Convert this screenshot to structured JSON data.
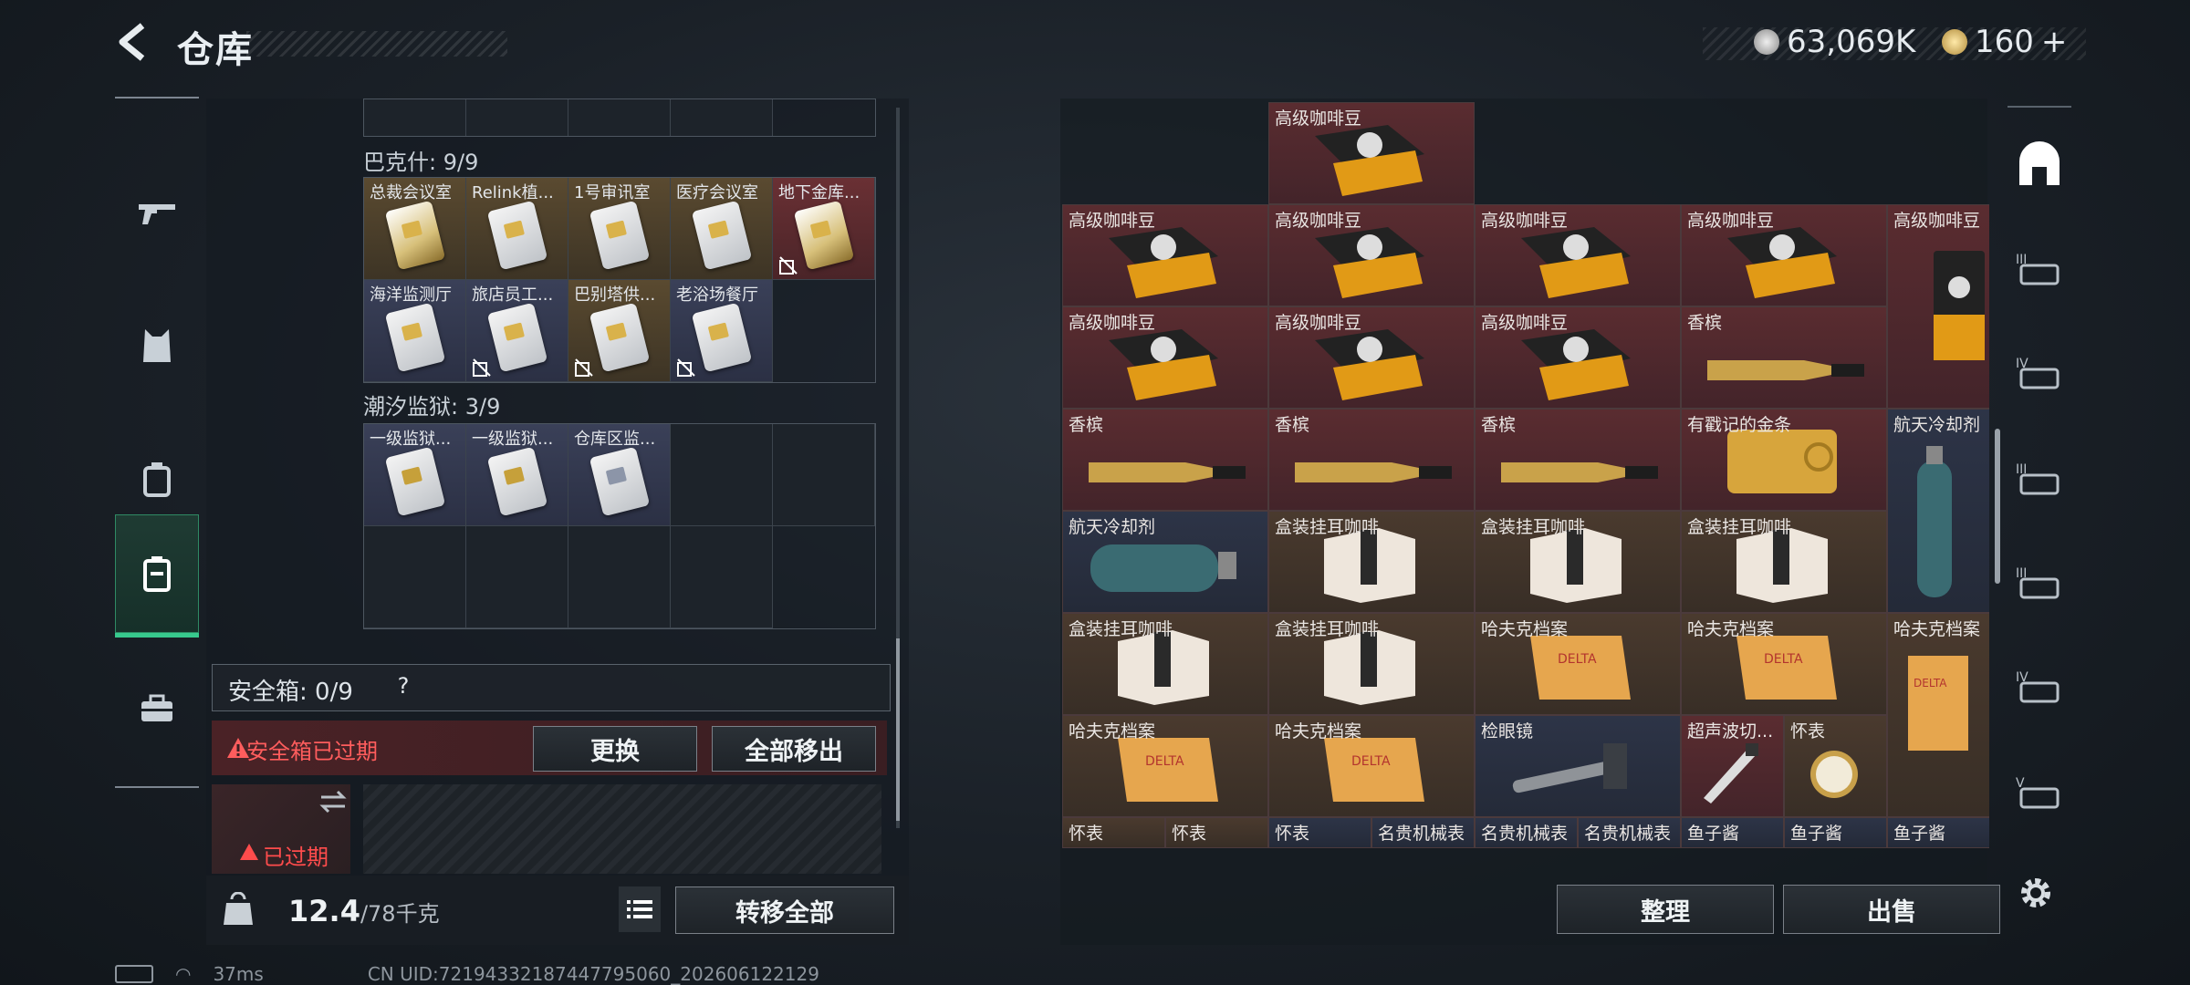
{
  "header": {
    "title": "仓库",
    "currency_1": "63,069K",
    "currency_2": "160",
    "currency_2_plus": "+"
  },
  "left_nav": [
    "weapon-icon",
    "armor-icon",
    "backpack-icon",
    "warehouse-icon",
    "briefcase-icon"
  ],
  "left": {
    "section_1": {
      "title": "巴克什: 9/9",
      "items": [
        "总裁会议室",
        "Relink植...",
        "1号审讯室",
        "医疗会议室",
        "地下金库...",
        "海洋监测厅",
        "旅店员工...",
        "巴别塔供...",
        "老浴场餐厅"
      ]
    },
    "section_2": {
      "title": "潮汐监狱: 3/9",
      "items": [
        "一级监狱...",
        "一级监狱...",
        "仓库区监..."
      ]
    },
    "safe_box": {
      "label": "安全箱: 0/9",
      "help": "?"
    },
    "expired": {
      "text": "安全箱已过期",
      "replace_btn": "更换",
      "remove_all_btn": "全部移出",
      "slot_text": "已过期"
    },
    "weight": {
      "value": "12.4",
      "max": "/78千克"
    },
    "transfer_all_btn": "转移全部"
  },
  "right": {
    "items": [
      {
        "label": ""
      },
      {
        "label": "高级咖啡豆"
      },
      {
        "label": ""
      },
      {
        "label": ""
      },
      {
        "label": ""
      },
      {
        "label": ""
      },
      {
        "label": ""
      },
      {
        "label": "高级咖啡豆"
      },
      {
        "label": "高级咖啡豆"
      },
      {
        "label": "高级咖啡豆"
      },
      {
        "label": "高级咖啡豆"
      },
      {
        "label": "高级咖啡豆"
      },
      {
        "label": "高级咖啡豆"
      },
      {
        "label": "高级咖啡豆"
      },
      {
        "label": "高级咖啡豆"
      },
      {
        "label": "香槟"
      },
      {
        "label": "香槟"
      },
      {
        "label": "香槟"
      },
      {
        "label": "香槟"
      },
      {
        "label": "有戳记的金条"
      },
      {
        "label": "航天冷却剂"
      },
      {
        "label": "航天冷却剂"
      },
      {
        "label": "盒装挂耳咖啡"
      },
      {
        "label": "盒装挂耳咖啡"
      },
      {
        "label": "盒装挂耳咖啡"
      },
      {
        "label": "盒装挂耳咖啡"
      },
      {
        "label": "盒装挂耳咖啡"
      },
      {
        "label": "哈夫克档案"
      },
      {
        "label": "哈夫克档案"
      },
      {
        "label": "哈夫克档案"
      },
      {
        "label": "哈夫克档案"
      },
      {
        "label": "哈夫克档案"
      },
      {
        "label": "检眼镜"
      },
      {
        "label": "超声波切..."
      },
      {
        "label": "怀表"
      },
      {
        "label": "怀表"
      },
      {
        "label": "怀表"
      },
      {
        "label": "怀表"
      },
      {
        "label": "名贵机械表"
      },
      {
        "label": "名贵机械表"
      },
      {
        "label": "名贵机械表"
      },
      {
        "label": "鱼子酱"
      },
      {
        "label": "鱼子酱"
      },
      {
        "label": "鱼子酱"
      }
    ],
    "sort_btn": "整理",
    "sell_btn": "出售"
  },
  "right_nav": [
    {
      "icon": "home-icon",
      "label": ""
    },
    {
      "icon": "case-iii-icon",
      "label": "III"
    },
    {
      "icon": "case-iv-icon",
      "label": "IV"
    },
    {
      "icon": "case-iii-icon",
      "label": "III"
    },
    {
      "icon": "case-iii-icon",
      "label": "III"
    },
    {
      "icon": "case-iv-icon",
      "label": "IV"
    },
    {
      "icon": "case-v-icon",
      "label": "V"
    }
  ],
  "footer": {
    "latency": "37ms",
    "uid": "CN UID:72194332187447795060_202606122129"
  },
  "colors": {
    "accent": "#37c98d",
    "danger": "#ff5d5d"
  }
}
